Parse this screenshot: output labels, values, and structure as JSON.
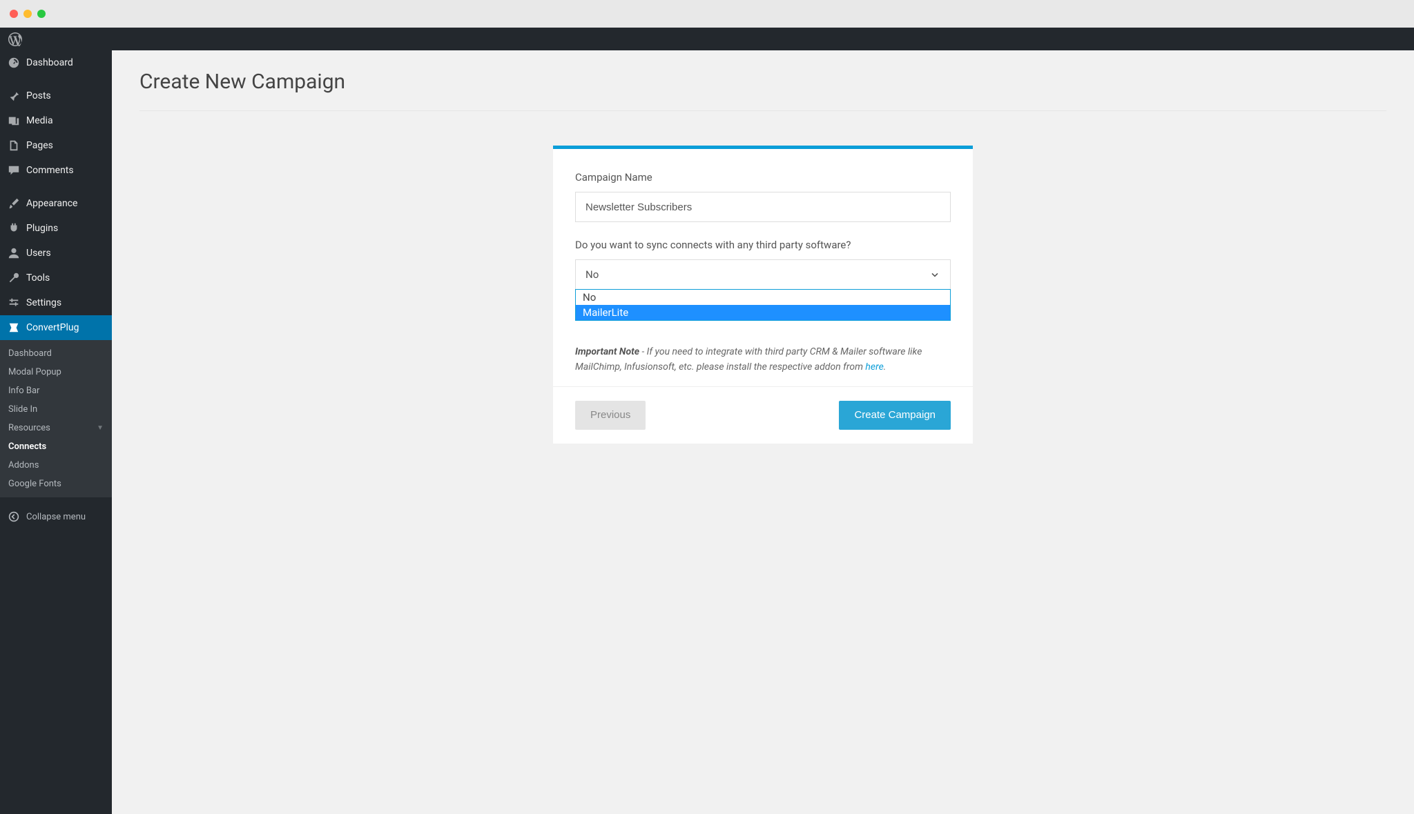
{
  "sidebar": {
    "items": [
      {
        "label": "Dashboard"
      },
      {
        "label": "Posts"
      },
      {
        "label": "Media"
      },
      {
        "label": "Pages"
      },
      {
        "label": "Comments"
      },
      {
        "label": "Appearance"
      },
      {
        "label": "Plugins"
      },
      {
        "label": "Users"
      },
      {
        "label": "Tools"
      },
      {
        "label": "Settings"
      },
      {
        "label": "ConvertPlug"
      }
    ],
    "submenu": [
      {
        "label": "Dashboard"
      },
      {
        "label": "Modal Popup"
      },
      {
        "label": "Info Bar"
      },
      {
        "label": "Slide In"
      },
      {
        "label": "Resources"
      },
      {
        "label": "Connects"
      },
      {
        "label": "Addons"
      },
      {
        "label": "Google Fonts"
      }
    ],
    "collapse_label": "Collapse menu"
  },
  "page": {
    "title": "Create New Campaign"
  },
  "form": {
    "campaign_name_label": "Campaign Name",
    "campaign_name_value": "Newsletter Subscribers",
    "sync_question": "Do you want to sync connects with any third party software?",
    "sync_selected": "No",
    "sync_options": [
      {
        "label": "No"
      },
      {
        "label": "MailerLite"
      }
    ],
    "note_strong": "Important Note",
    "note_text": " - If you need to integrate with third party CRM & Mailer software like MailChimp, Infusionsoft, etc. please install the respective addon from ",
    "note_link": "here",
    "note_period": "."
  },
  "buttons": {
    "previous": "Previous",
    "create": "Create Campaign"
  }
}
